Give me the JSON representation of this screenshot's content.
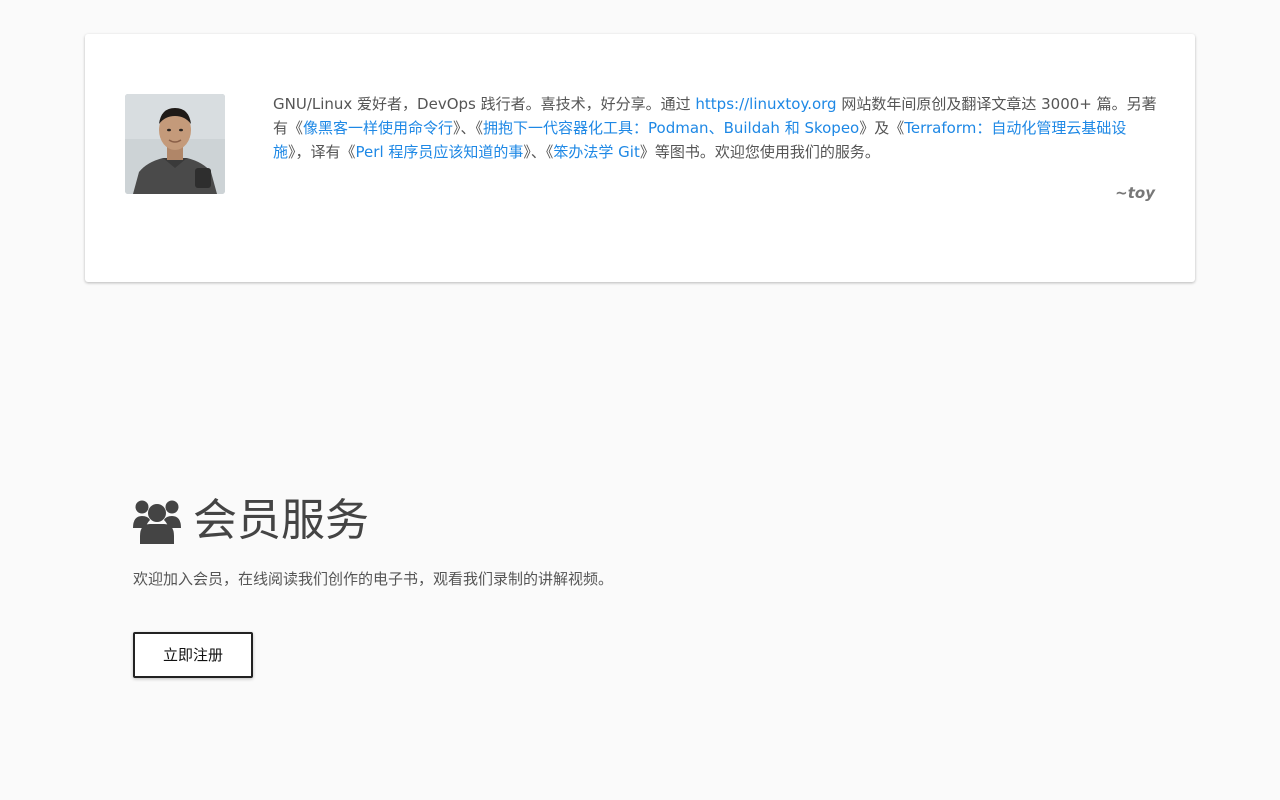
{
  "author": {
    "bio": {
      "p1": "GNU/Linux 爱好者，DevOps 践行者。喜技术，好分享。通过 ",
      "link_site": "https://linuxtoy.org",
      "p2": " 网站数年间原创及翻译文章达 3000+ 篇。另著有《",
      "book1": "像黑客一样使用命令行",
      "p3": "》、《",
      "book2": "拥抱下一代容器化工具：Podman、Buildah 和 Skopeo",
      "p4": "》及《",
      "book3": "Terraform：自动化管理云基础设施",
      "p5": "》，译有《",
      "book4": "Perl 程序员应该知道的事",
      "p6": "》、《",
      "book5": "笨办法学 Git",
      "p7": "》等图书。欢迎您使用我们的服务。"
    },
    "signature": "~toy"
  },
  "membership": {
    "icon": "users-icon",
    "title": "会员服务",
    "description": "欢迎加入会员，在线阅读我们创作的电子书，观看我们录制的讲解视频。",
    "register_label": "立即注册"
  },
  "colors": {
    "link": "#1e88e5",
    "text": "#555555",
    "background": "#fafafa"
  }
}
